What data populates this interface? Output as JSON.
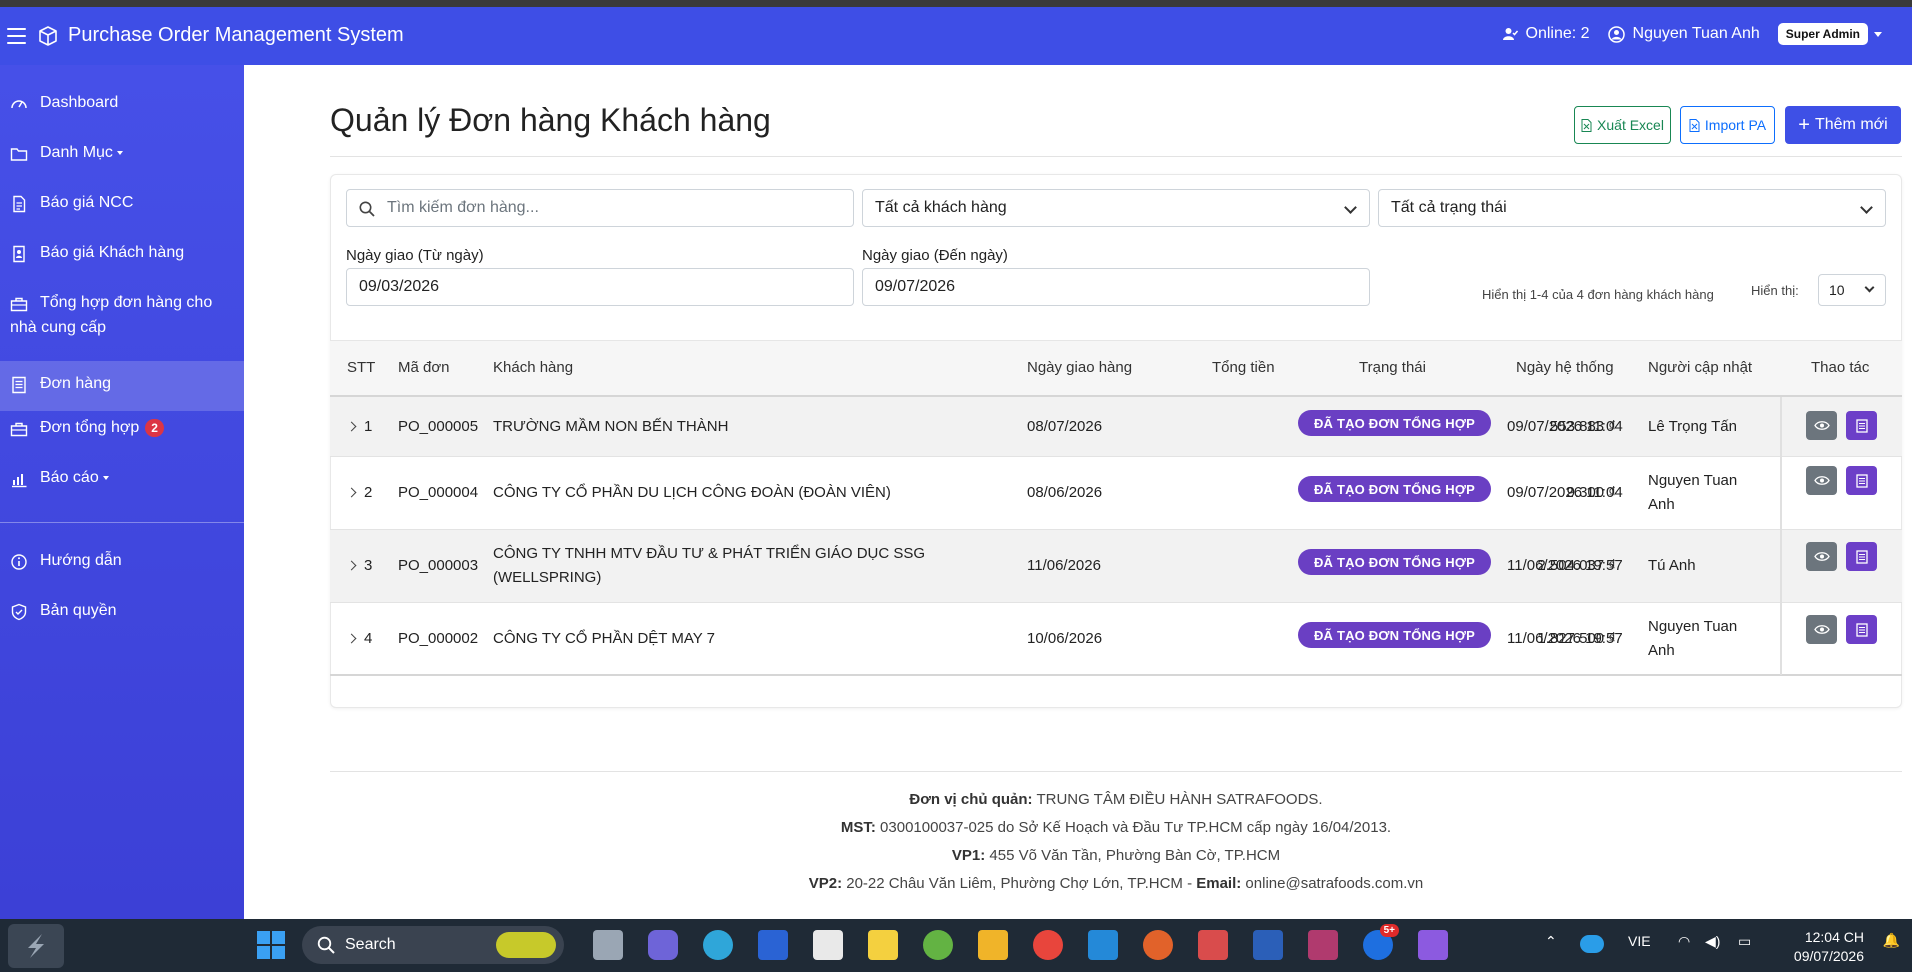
{
  "app": {
    "title": "Purchase Order Management System",
    "online": "Online: 2",
    "user": "Nguyen Tuan Anh",
    "role": "Super Admin"
  },
  "sidebar": {
    "items": [
      {
        "label": "Dashboard"
      },
      {
        "label": "Danh Mục"
      },
      {
        "label": "Báo giá NCC"
      },
      {
        "label": "Báo giá Khách hàng"
      },
      {
        "label": "Tổng hợp đơn hàng cho"
      },
      {
        "label": "Đơn hàng"
      },
      {
        "label": "Đơn tổng hợp",
        "badge": "2"
      },
      {
        "label": "Báo cáo"
      },
      {
        "label": "Hướng dẫn"
      },
      {
        "label": "Bản quyền"
      }
    ],
    "item4_line2": "nhà cung cấp"
  },
  "page": {
    "title": "Quản lý Đơn hàng Khách hàng",
    "btn_excel": "Xuất Excel",
    "btn_import": "Import PA",
    "btn_add": "Thêm mới"
  },
  "filters": {
    "search_placeholder": "Tìm kiếm đơn hàng...",
    "customer": "Tất cả khách hàng",
    "status": "Tất cả trạng thái",
    "from_label": "Ngày giao (Từ ngày)",
    "from_value": "09/03/2026",
    "to_label": "Ngày giao (Đến ngày)",
    "to_value": "09/07/2026",
    "showing": "Hiển thị 1-4 của 4 đơn hàng khách hàng",
    "page_size_label": "Hiển thị:",
    "page_size": "10"
  },
  "table": {
    "headers": [
      "STT",
      "Mã đơn",
      "Khách hàng",
      "Ngày giao hàng",
      "Tổng tiền",
      "Trạng thái",
      "Ngày hệ thống",
      "Người cập nhật",
      "Thao tác"
    ],
    "rows": [
      {
        "stt": "1",
        "code": "PO_000005",
        "customer": "TRƯỜNG MẦM NON BẾN THÀNH",
        "customer2": "",
        "date": "08/07/2026",
        "total": "553.883 ₫",
        "status": "ĐÃ TẠO ĐƠN TỔNG HỢP",
        "sys": "09/07/2026 11:04",
        "updater": "Lê Trọng Tấn",
        "updater2": ""
      },
      {
        "stt": "2",
        "code": "PO_000004",
        "customer": "CÔNG TY CỔ PHẦN DU LỊCH CÔNG ĐOÀN (ĐOÀN VIÊN)",
        "customer2": "",
        "date": "08/06/2026",
        "total": "9.300 ₫",
        "status": "ĐÃ TẠO ĐƠN TỔNG HỢP",
        "sys": "09/07/2026 11:04",
        "updater": "Nguyen Tuan",
        "updater2": "Anh"
      },
      {
        "stt": "3",
        "code": "PO_000003",
        "customer": "CÔNG TY TNHH MTV ĐẦU TƯ & PHÁT TRIỂN GIÁO DỤC SSG",
        "customer2": "(WELLSPRING)",
        "date": "11/06/2026",
        "total": "2.504.037 ₫",
        "status": "ĐÃ TẠO ĐƠN TỔNG HỢP",
        "sys": "11/06/2026 19:57",
        "updater": "Tú Anh",
        "updater2": ""
      },
      {
        "stt": "4",
        "code": "PO_000002",
        "customer": "CÔNG TY CỔ PHẦN DỆT MAY 7",
        "customer2": "",
        "date": "10/06/2026",
        "total": "1.827.500 ₫",
        "status": "ĐÃ TẠO ĐƠN TỔNG HỢP",
        "sys": "11/06/2026 19:57",
        "updater": "Nguyen Tuan",
        "updater2": "Anh"
      }
    ]
  },
  "footer": {
    "l1_label": "Đơn vị chủ quản:",
    "l1_text": " TRUNG TÂM ĐIỀU HÀNH SATRAFOODS.",
    "l2_label": "MST:",
    "l2_text": " 0300100037-025 do Sở Kế Hoạch và Đầu Tư TP.HCM cấp ngày 16/04/2013.",
    "l3_label": "VP1:",
    "l3_text": " 455 Võ Văn Tần, Phường Bàn Cờ, TP.HCM",
    "l4_label": "VP2:",
    "l4_text": " 20-22 Châu Văn Liêm, Phường Chợ Lớn, TP.HCM - ",
    "l4_label2": "Email:",
    "l4_text2": " online@satrafoods.com.vn"
  },
  "taskbar": {
    "search": "Search",
    "lang": "VIE",
    "time": "12:04 CH",
    "date": "09/07/2026",
    "zalo_badge": "5+"
  },
  "colors": {
    "primary": "#3e4ee6",
    "status": "#6a3fc3",
    "success": "#198754"
  }
}
